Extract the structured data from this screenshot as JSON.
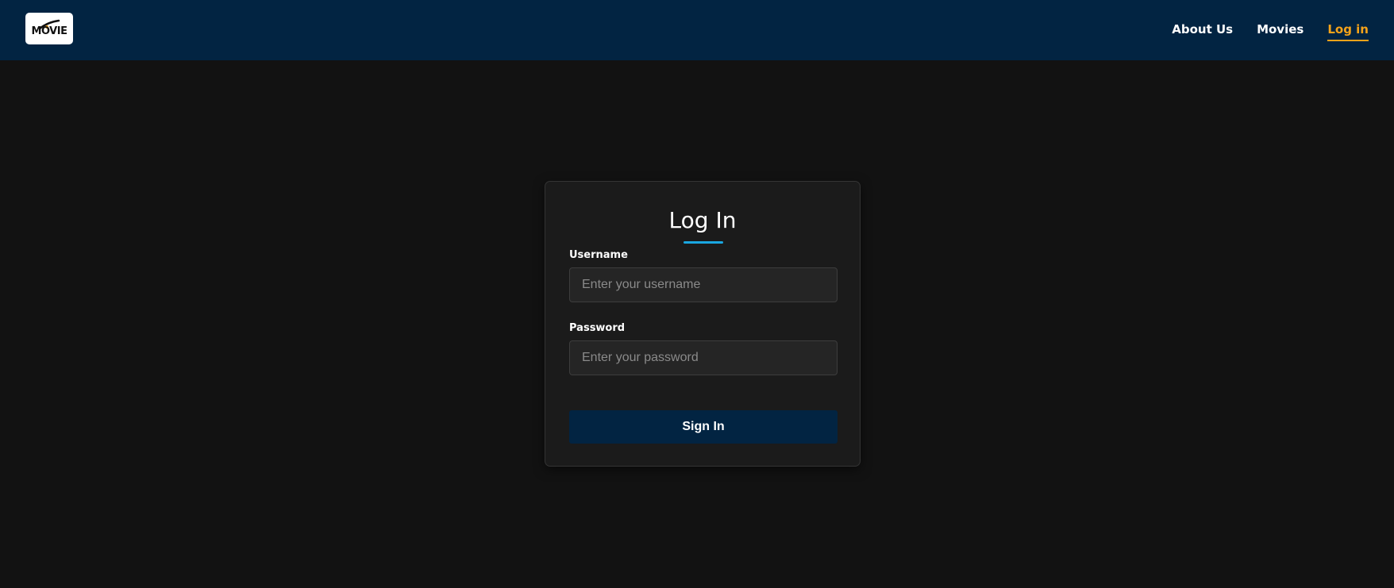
{
  "header": {
    "logo_text": "MOVIE",
    "nav": [
      {
        "label": "About Us",
        "active": false
      },
      {
        "label": "Movies",
        "active": false
      },
      {
        "label": "Log in",
        "active": true
      }
    ]
  },
  "login": {
    "title": "Log In",
    "username_label": "Username",
    "username_placeholder": "Enter your username",
    "username_value": "",
    "password_label": "Password",
    "password_placeholder": "Enter your password",
    "password_value": "",
    "submit_label": "Sign In"
  },
  "colors": {
    "header_bg": "#022442",
    "page_bg": "#121212",
    "card_bg": "#1b1b1b",
    "active_nav": "#f5a31a",
    "title_accent": "#1aa7e0",
    "button_bg": "#022442"
  },
  "icons": [
    "movie-logo-icon"
  ]
}
